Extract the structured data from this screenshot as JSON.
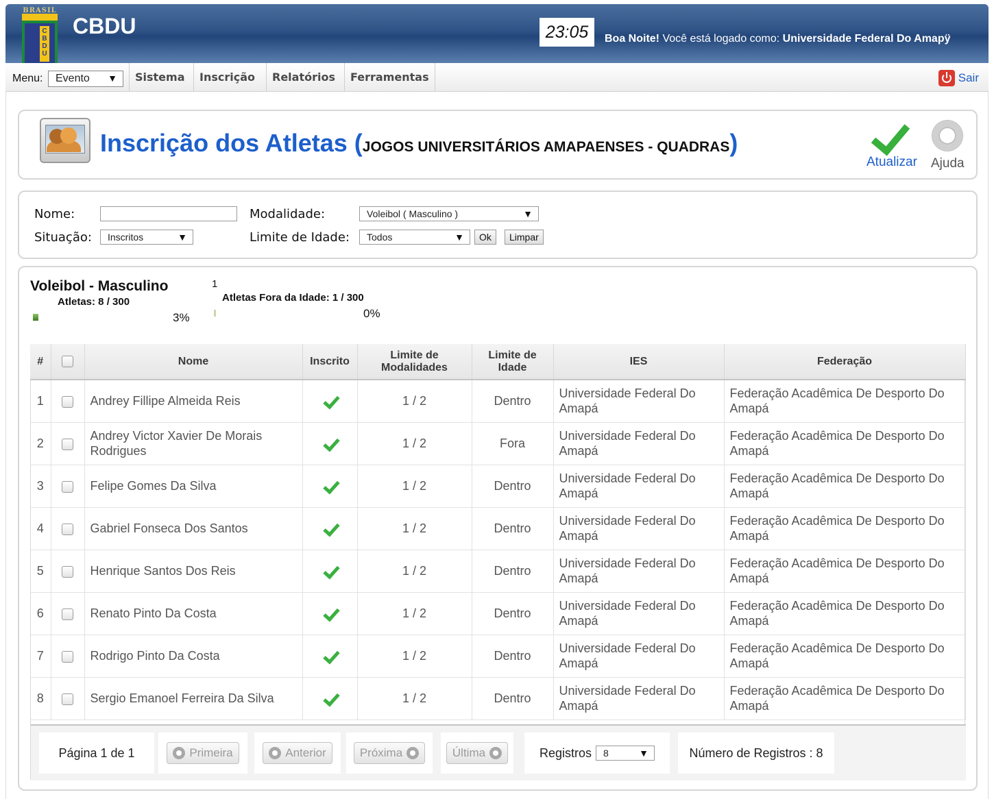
{
  "header": {
    "logo_text": "BRASIL",
    "logo_letters": "CBDU",
    "app_title": "CBDU",
    "clock": "23:05",
    "greeting_bold": "Boa Noite!",
    "greeting_text": " Você está logado como: ",
    "user_name": "Universidade Federal Do Amapÿ"
  },
  "menu": {
    "label": "Menu:",
    "select_value": "Evento",
    "items": [
      "Sistema",
      "Inscrição",
      "Relatórios",
      "Ferramentas"
    ],
    "exit_label": "Sair"
  },
  "title": {
    "main": "Inscrição dos Atletas",
    "open_paren": " (",
    "event": "JOGOS UNIVERSITÁRIOS AMAPAENSES - QUADRAS",
    "close_paren": ")",
    "refresh_label": "Atualizar",
    "help_label": "Ajuda"
  },
  "filters": {
    "name_label": "Nome:",
    "name_value": "",
    "modality_label": "Modalidade:",
    "modality_value": "Voleibol ( Masculino )",
    "status_label": "Situação:",
    "status_value": "Inscritos",
    "age_label": "Limite de Idade:",
    "age_value": "Todos",
    "ok_label": "Ok",
    "clear_label": "Limpar"
  },
  "stats": {
    "modality_title": "Voleibol - Masculino",
    "athletes_label": "Atletas: 8 / 300",
    "athletes_percent": "3%",
    "athletes_fraction": 0.03,
    "out_of_age_count": "1",
    "out_of_age_label": "Atletas Fora da Idade: 1 / 300",
    "out_of_age_percent": "0%",
    "out_of_age_fraction": 0.0
  },
  "table": {
    "headers": {
      "index": "#",
      "name": "Nome",
      "enrolled": "Inscrito",
      "modality_limit": "Limite de Modalidades",
      "age_limit": "Limite de Idade",
      "ies": "IES",
      "federation": "Federação"
    },
    "rows": [
      {
        "n": "1",
        "name": "Andrey Fillipe Almeida Reis",
        "mod": "1 / 2",
        "age": "Dentro",
        "ies": "Universidade Federal Do Amapá",
        "fed": "Federação Acadêmica De Desporto Do Amapá"
      },
      {
        "n": "2",
        "name": "Andrey Victor Xavier De Morais Rodrigues",
        "mod": "1 / 2",
        "age": "Fora",
        "ies": "Universidade Federal Do Amapá",
        "fed": "Federação Acadêmica De Desporto Do Amapá"
      },
      {
        "n": "3",
        "name": "Felipe Gomes Da Silva",
        "mod": "1 / 2",
        "age": "Dentro",
        "ies": "Universidade Federal Do Amapá",
        "fed": "Federação Acadêmica De Desporto Do Amapá"
      },
      {
        "n": "4",
        "name": "Gabriel Fonseca Dos Santos",
        "mod": "1 / 2",
        "age": "Dentro",
        "ies": "Universidade Federal Do Amapá",
        "fed": "Federação Acadêmica De Desporto Do Amapá"
      },
      {
        "n": "5",
        "name": "Henrique Santos Dos Reis",
        "mod": "1 / 2",
        "age": "Dentro",
        "ies": "Universidade Federal Do Amapá",
        "fed": "Federação Acadêmica De Desporto Do Amapá"
      },
      {
        "n": "6",
        "name": "Renato Pinto Da Costa",
        "mod": "1 / 2",
        "age": "Dentro",
        "ies": "Universidade Federal Do Amapá",
        "fed": "Federação Acadêmica De Desporto Do Amapá"
      },
      {
        "n": "7",
        "name": "Rodrigo Pinto Da Costa",
        "mod": "1 / 2",
        "age": "Dentro",
        "ies": "Universidade Federal Do Amapá",
        "fed": "Federação Acadêmica De Desporto Do Amapá"
      },
      {
        "n": "8",
        "name": "Sergio Emanoel Ferreira Da Silva",
        "mod": "1 / 2",
        "age": "Dentro",
        "ies": "Universidade Federal Do Amapá",
        "fed": "Federação Acadêmica De Desporto Do Amapá"
      }
    ]
  },
  "pager": {
    "page_info": "Página 1 de 1",
    "first": "Primeira",
    "prev": "Anterior",
    "next": "Próxima",
    "last": "Última",
    "records_label": "Registros",
    "records_value": "8",
    "total": "Número de Registros : 8"
  },
  "colors": {
    "header_blue": "#2f5386",
    "title_blue": "#1d5fcc",
    "check_green": "#37b03c",
    "exit_red": "#d9392f"
  }
}
